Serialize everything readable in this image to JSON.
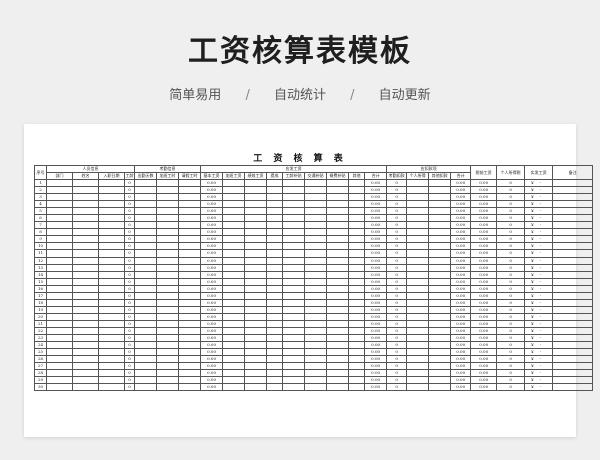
{
  "hero": {
    "title": "工资核算表模板",
    "tags": [
      "简单易用",
      "自动统计",
      "自动更新"
    ],
    "separator": "/"
  },
  "sheet": {
    "title": "工 资 核 算 表",
    "header_top": {
      "seq": "序号",
      "person_group": "人员信息",
      "attendance_group": "考勤信息",
      "payable_group": "应发工资",
      "deduct_group": "应扣款项",
      "tax_base": "税前工资",
      "income_tax": "个人所得税",
      "net_pay": "实发工资",
      "remark": "备注"
    },
    "header_sub": [
      "部门",
      "姓名",
      "入职日期",
      "工龄",
      "出勤天数",
      "加班工时",
      "请假工时",
      "基本工资",
      "加班工资",
      "绩效工资",
      "提成",
      "工龄补贴",
      "交通补贴",
      "餐费补贴",
      "其他",
      "合计",
      "考勤扣款",
      "个人所得",
      "其他扣款",
      "合计"
    ],
    "cells": {
      "seniority": "0",
      "overtime_pay": "0.00",
      "payable_total": "0.00",
      "attendance_deduct": "0",
      "deduct_total": "0.00",
      "tax_base": "0.00",
      "income_tax": "0",
      "net_currency": "¥",
      "net_dash": "-"
    },
    "row_count": 30,
    "colors": {
      "grid": "#555555",
      "text": "#222222"
    }
  }
}
